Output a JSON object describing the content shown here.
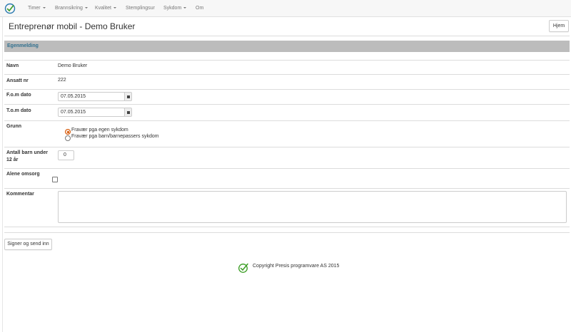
{
  "nav": {
    "items": [
      {
        "label": "Timer",
        "dropdown": true
      },
      {
        "label": "Brannsikring",
        "dropdown": true
      },
      {
        "label": "Kvalitet",
        "dropdown": true
      },
      {
        "label": "Stemplingsur",
        "dropdown": false
      },
      {
        "label": "Sykdom",
        "dropdown": true
      },
      {
        "label": "Om",
        "dropdown": false
      }
    ]
  },
  "header": {
    "title": "Entreprenør mobil - Demo Bruker",
    "home_label": "Hjem"
  },
  "section": {
    "title": "Egenmelding"
  },
  "form": {
    "name_label": "Navn",
    "name_value": "Demo Bruker",
    "employee_label": "Ansatt nr",
    "employee_value": "222",
    "from_label": "F.o.m dato",
    "from_value": "07.05.2015",
    "to_label": "T.o.m dato",
    "to_value": "07.05.2015",
    "reason_label": "Grunn",
    "reason_options": [
      {
        "label": "Fravær pga egen sykdom",
        "selected": true
      },
      {
        "label": "Fravær pga barn/barnepassers sykdom",
        "selected": false
      }
    ],
    "children_label_line1": "Antall barn under",
    "children_label_line2": "12 år",
    "children_value": "0",
    "sole_care_label": "Alene omsorg",
    "sole_care_checked": false,
    "comment_label": "Kommentar",
    "comment_value": "",
    "submit_label": "Signer og send inn"
  },
  "footer": {
    "copyright": "Copyright Presis programvare AS 2015"
  },
  "colors": {
    "accent_orange": "#d35400",
    "section_title": "#31708f",
    "section_bar": "#bcbcbc",
    "logo_green": "#3a9d23",
    "logo_blue": "#2a7ab0"
  }
}
